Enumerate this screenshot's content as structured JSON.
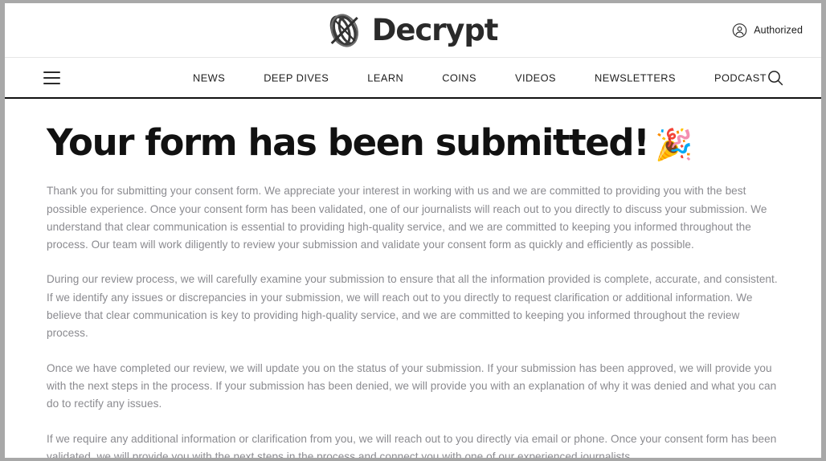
{
  "header": {
    "brand_name": "Decrypt",
    "logo_icon": "decrypt-logo-mark",
    "auth": {
      "icon": "user-circle-icon",
      "label": "Authorized"
    }
  },
  "nav": {
    "menu_icon": "hamburger-menu-icon",
    "search_icon": "search-icon",
    "items": [
      {
        "label": "NEWS"
      },
      {
        "label": "DEEP DIVES"
      },
      {
        "label": "LEARN"
      },
      {
        "label": "COINS"
      },
      {
        "label": "VIDEOS"
      },
      {
        "label": "NEWSLETTERS"
      },
      {
        "label": "PODCAST"
      }
    ]
  },
  "main": {
    "title": "Your form has been submitted!",
    "title_emoji": "🎉",
    "paragraphs": [
      "Thank you for submitting your consent form. We appreciate your interest in working with us and we are committed to providing you with the best possible experience. Once your consent form has been validated, one of our journalists will reach out to you directly to discuss your submission. We understand that clear communication is essential to providing high-quality service, and we are committed to keeping you informed throughout the process. Our team will work diligently to review your submission and validate your consent form as quickly and efficiently as possible.",
      "During our review process, we will carefully examine your submission to ensure that all the information provided is complete, accurate, and consistent. If we identify any issues or discrepancies in your submission, we will reach out to you directly to request clarification or additional information. We believe that clear communication is key to providing high-quality service, and we are committed to keeping you informed throughout the review process.",
      "Once we have completed our review, we will update you on the status of your submission. If your submission has been approved, we will provide you with the next steps in the process. If your submission has been denied, we will provide you with an explanation of why it was denied and what you can do to rectify any issues.",
      "If we require any additional information or clarification from you, we will reach out to you directly via email or phone. Once your consent form has been validated, we will provide you with the next steps in the process and connect you with one of our experienced journalists."
    ]
  },
  "colors": {
    "page_background": "#ffffff",
    "outer_frame": "#a8a8a8",
    "nav_border": "#111111",
    "heading": "#111111",
    "body_text": "#8a8a8f",
    "brand": "#2a2a2a"
  }
}
